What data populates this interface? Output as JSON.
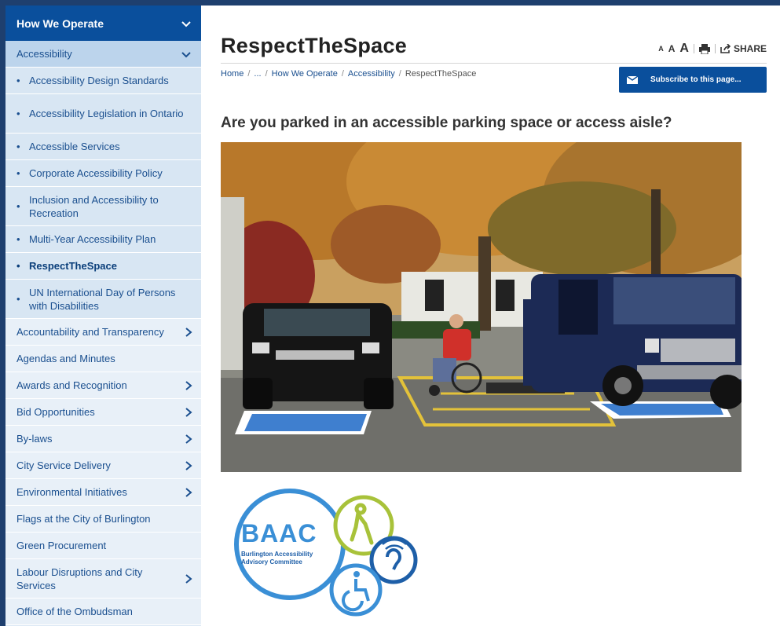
{
  "sidebar": {
    "header": "How We Operate",
    "subheader": "Accessibility",
    "sub_items": [
      {
        "label": "Accessibility Design Standards"
      },
      {
        "label": "Accessibility Legislation in Ontario"
      },
      {
        "label": "Accessible Services"
      },
      {
        "label": "Corporate Accessibility Policy"
      },
      {
        "label": "Inclusion and Accessibility to Recreation"
      },
      {
        "label": "Multi-Year Accessibility Plan"
      },
      {
        "label": "RespectTheSpace"
      },
      {
        "label": "UN International Day of Persons with Disabilities"
      }
    ],
    "items": [
      {
        "label": "Accountability and Transparency"
      },
      {
        "label": "Agendas and Minutes"
      },
      {
        "label": "Awards and Recognition"
      },
      {
        "label": "Bid Opportunities"
      },
      {
        "label": "By-laws"
      },
      {
        "label": "City Service Delivery"
      },
      {
        "label": "Environmental Initiatives"
      },
      {
        "label": "Flags at the City of Burlington"
      },
      {
        "label": "Green Procurement"
      },
      {
        "label": "Labour Disruptions and City Services"
      },
      {
        "label": "Office of the Ombudsman"
      }
    ]
  },
  "page": {
    "title": "RespectTheSpace",
    "font_small": "A",
    "font_medium": "A",
    "font_large": "A",
    "share_label": "SHARE",
    "breadcrumb": {
      "home": "Home",
      "ellipsis": "...",
      "level1": "How We Operate",
      "level2": "Accessibility",
      "current": "RespectTheSpace",
      "separator": "/"
    },
    "subscribe_label": "Subscribe to this page...",
    "question": "Are you parked in an accessible parking space or access aisle?"
  },
  "logo": {
    "acronym": "BAAC",
    "line1": "Burlington Accessibility",
    "line2": "Advisory Committee"
  },
  "colors": {
    "brand_blue": "#0a4f9c",
    "sidebar_bg": "#dbe8f4",
    "link": "#1a4f8f"
  }
}
